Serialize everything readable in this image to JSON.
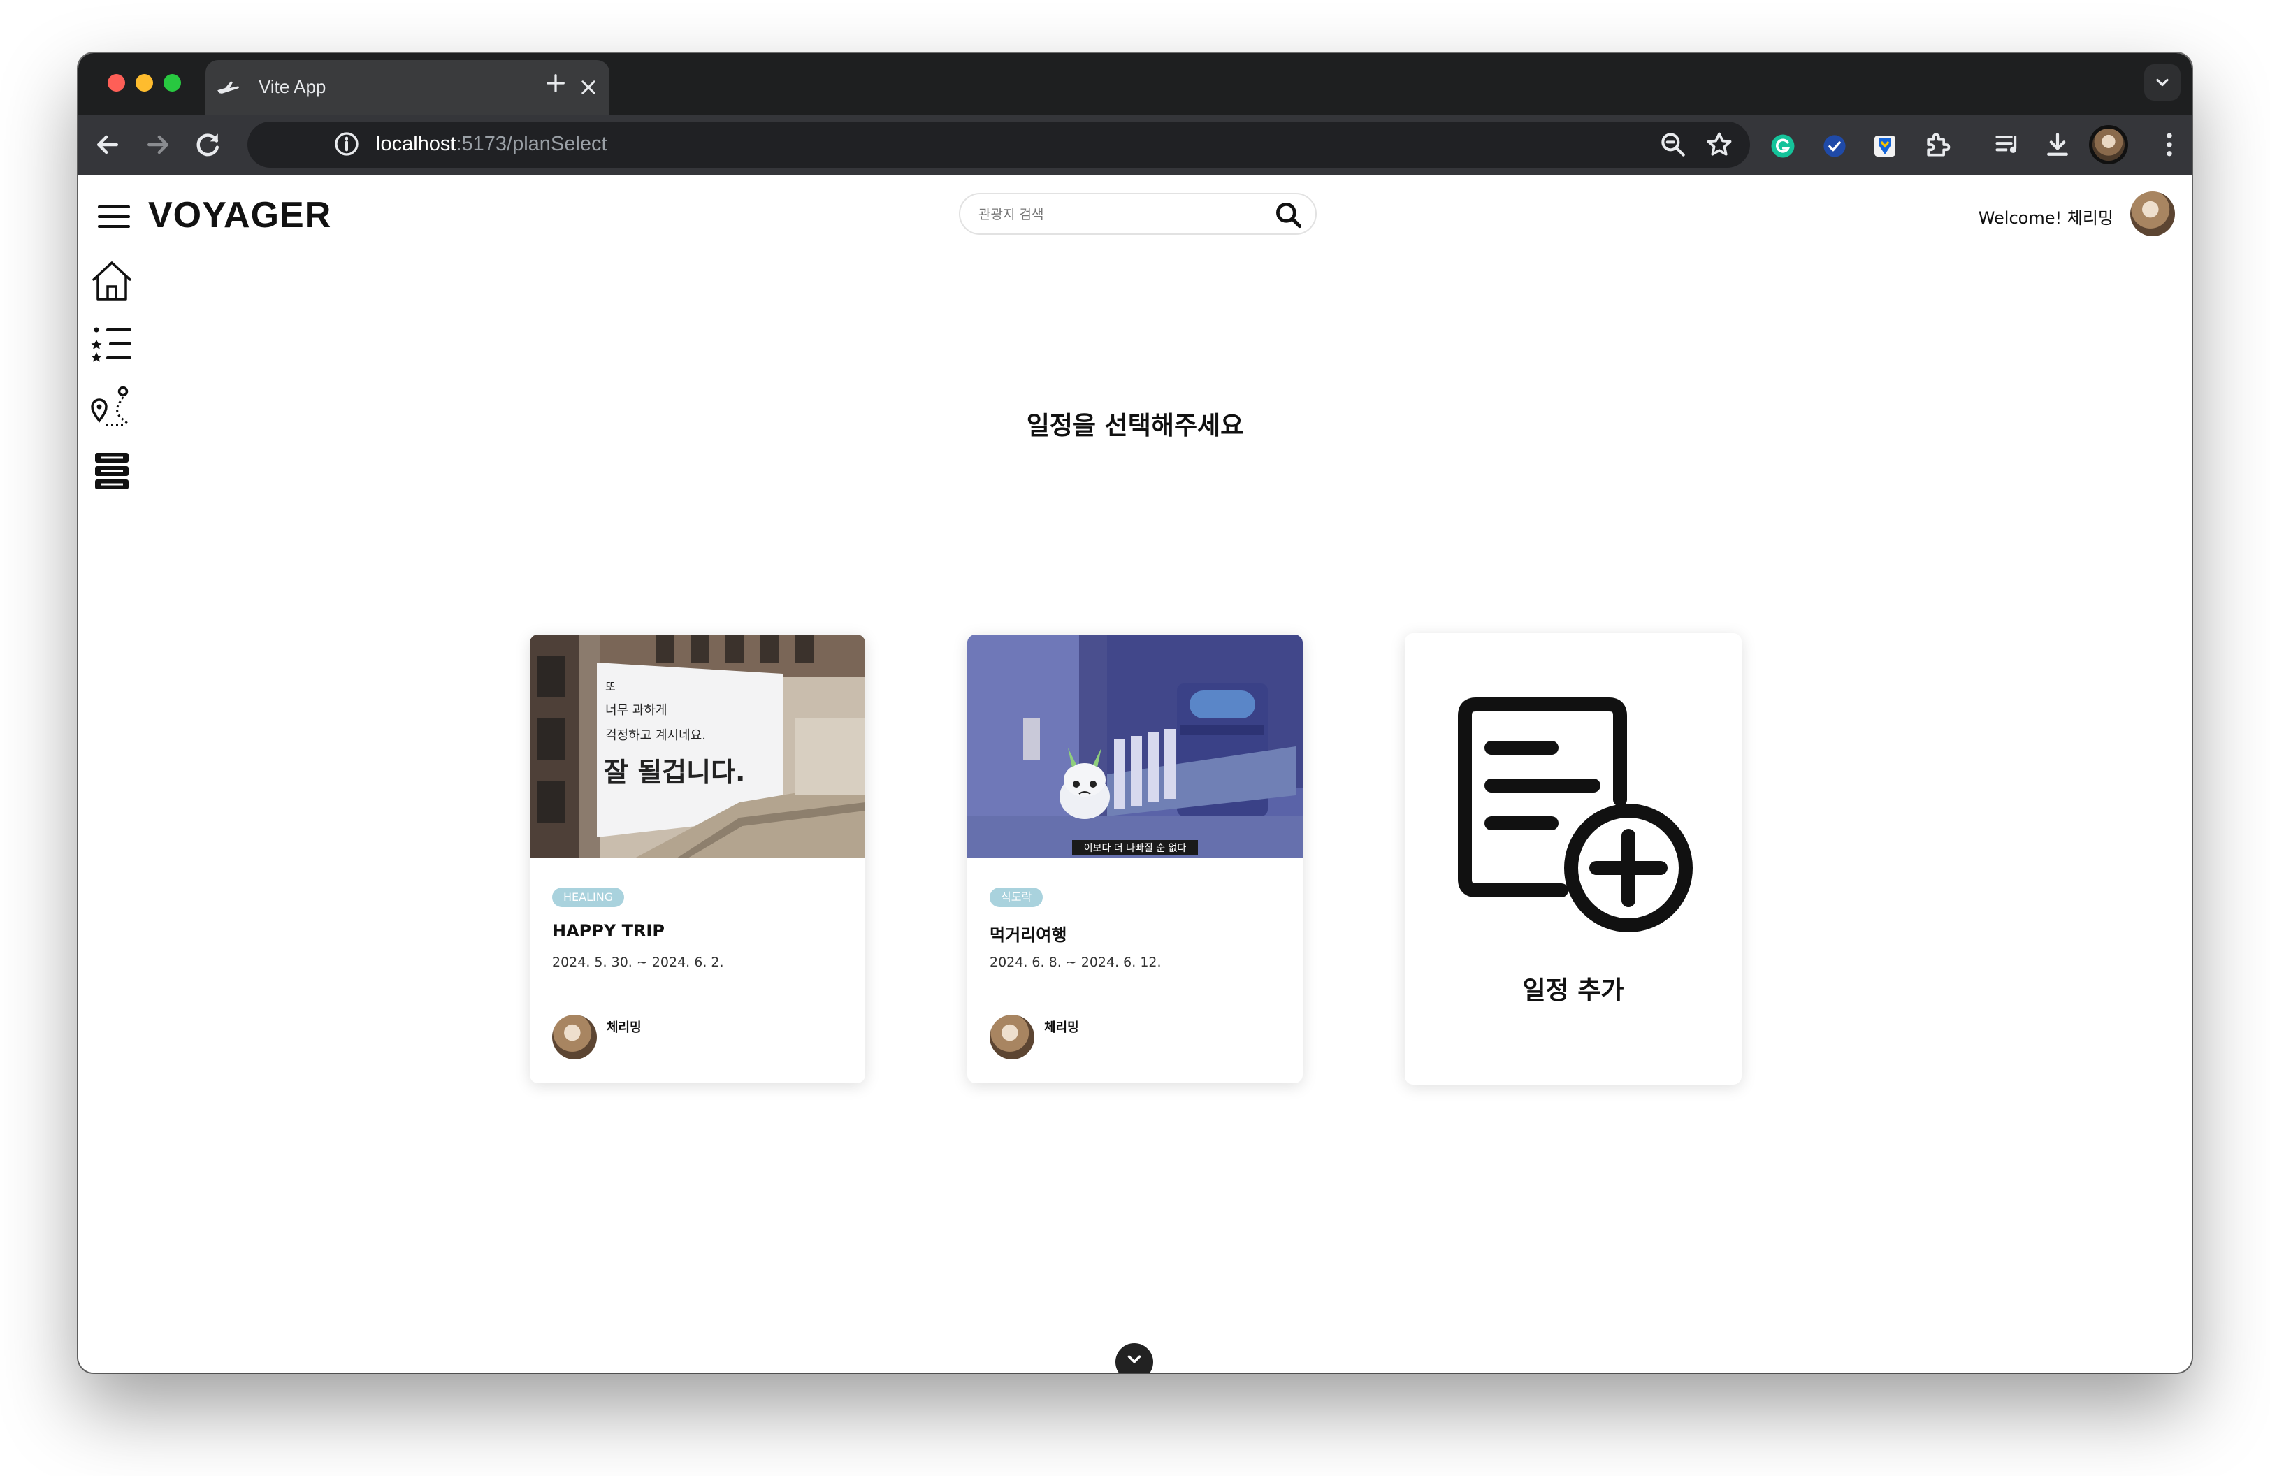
{
  "browser": {
    "tab_title": "Vite App",
    "url_host": "localhost",
    "url_path": ":5173/planSelect"
  },
  "header": {
    "brand": "VOYAGER",
    "search_placeholder": "관광지 검색",
    "welcome": "Welcome! 체리밍"
  },
  "sidebar": {
    "icons": [
      "home-icon",
      "list-icon",
      "route-icon",
      "storage-icon"
    ]
  },
  "main": {
    "heading": "일정을 선택해주세요",
    "plans": [
      {
        "badge": "HEALING",
        "title": "HAPPY TRIP",
        "dates": "2024. 5. 30. ~ 2024. 6. 2.",
        "author": "체리밍",
        "image": {
          "lines": [
            "또",
            "너무 과하게",
            "걱정하고 계시네요.",
            "잘 될겁니다."
          ]
        }
      },
      {
        "badge": "식도락",
        "title": "먹거리여행",
        "dates": "2024. 6. 8. ~ 2024. 6. 12.",
        "author": "체리밍",
        "image": {
          "caption": "이보다 더 나빠질 순 없다"
        }
      }
    ],
    "add_plan_label": "일정 추가"
  },
  "colors": {
    "badge": "#a9d2dd",
    "chrome_dark": "#1e1f20",
    "toolbar": "#35363a"
  }
}
